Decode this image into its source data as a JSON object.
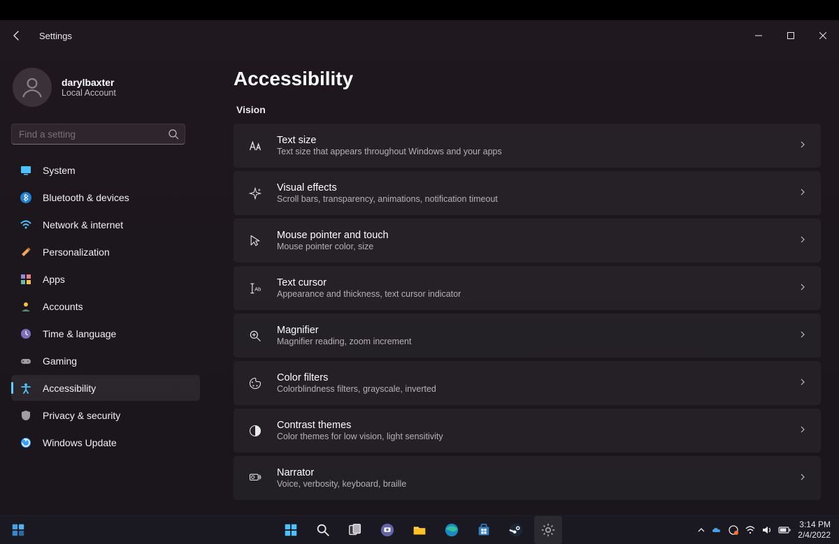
{
  "app_title": "Settings",
  "account": {
    "name": "darylbaxter",
    "type": "Local Account"
  },
  "search": {
    "placeholder": "Find a setting"
  },
  "sidebar": {
    "items": [
      {
        "label": "System",
        "icon": "display-icon",
        "color": "#4cc2ff"
      },
      {
        "label": "Bluetooth & devices",
        "icon": "bluetooth-icon",
        "color": "#4cc2ff"
      },
      {
        "label": "Network & internet",
        "icon": "wifi-icon",
        "color": "#4cc2ff"
      },
      {
        "label": "Personalization",
        "icon": "paint-icon",
        "color": "#f2a65a"
      },
      {
        "label": "Apps",
        "icon": "grid-icon",
        "color": "#8e8cd8"
      },
      {
        "label": "Accounts",
        "icon": "person-icon",
        "color": "#f2c14e"
      },
      {
        "label": "Time & language",
        "icon": "clock-lang-icon",
        "color": "#a18fff"
      },
      {
        "label": "Gaming",
        "icon": "game-icon",
        "color": "#9e9e9e"
      },
      {
        "label": "Accessibility",
        "icon": "accessibility-icon",
        "color": "#4cc2ff",
        "active": true
      },
      {
        "label": "Privacy & security",
        "icon": "shield-icon",
        "color": "#9e9e9e"
      },
      {
        "label": "Windows Update",
        "icon": "update-icon",
        "color": "#3aa0ff"
      }
    ]
  },
  "main": {
    "title": "Accessibility",
    "section": "Vision",
    "rows": [
      {
        "title": "Text size",
        "sub": "Text size that appears throughout Windows and your apps",
        "icon": "text-size-icon"
      },
      {
        "title": "Visual effects",
        "sub": "Scroll bars, transparency, animations, notification timeout",
        "icon": "sparkle-icon"
      },
      {
        "title": "Mouse pointer and touch",
        "sub": "Mouse pointer color, size",
        "icon": "cursor-icon"
      },
      {
        "title": "Text cursor",
        "sub": "Appearance and thickness, text cursor indicator",
        "icon": "text-cursor-icon"
      },
      {
        "title": "Magnifier",
        "sub": "Magnifier reading, zoom increment",
        "icon": "magnifier-icon"
      },
      {
        "title": "Color filters",
        "sub": "Colorblindness filters, grayscale, inverted",
        "icon": "palette-icon"
      },
      {
        "title": "Contrast themes",
        "sub": "Color themes for low vision, light sensitivity",
        "icon": "contrast-icon"
      },
      {
        "title": "Narrator",
        "sub": "Voice, verbosity, keyboard, braille",
        "icon": "narrator-icon"
      }
    ]
  },
  "taskbar": {
    "time": "3:14 PM",
    "date": "2/4/2022"
  }
}
